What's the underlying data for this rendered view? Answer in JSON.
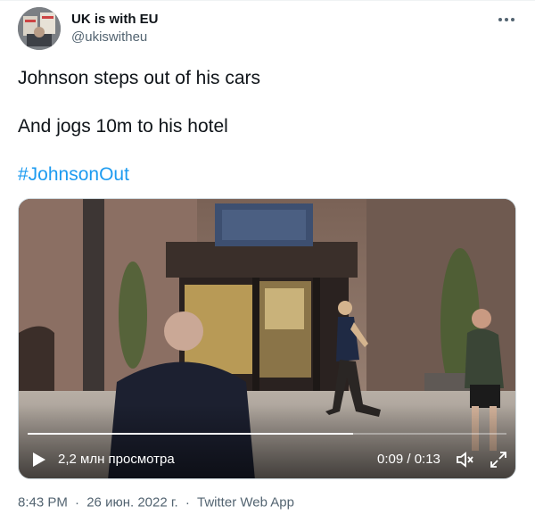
{
  "author": {
    "name": "UK is with EU",
    "handle": "@ukiswitheu",
    "avatar_icon": "avatar-photo"
  },
  "menu": {
    "more_icon": "more-horizontal-icon"
  },
  "tweet": {
    "line1": "Johnson steps out of his cars",
    "line2": "And jogs 10m to his hotel",
    "hashtag": "#JohnsonOut"
  },
  "video": {
    "views": "2,2 млн просмотра",
    "time": "0:09 / 0:13",
    "progress": 0.68,
    "play_icon": "play-icon",
    "volume_icon": "volume-icon",
    "fullscreen_icon": "fullscreen-icon"
  },
  "meta": {
    "time": "8:43 PM",
    "separator": "·",
    "date": "26 июн. 2022 г.",
    "source": "Twitter Web App"
  },
  "colors": {
    "text": "#0f1419",
    "secondary": "#536471",
    "link": "#1d9bf0"
  }
}
